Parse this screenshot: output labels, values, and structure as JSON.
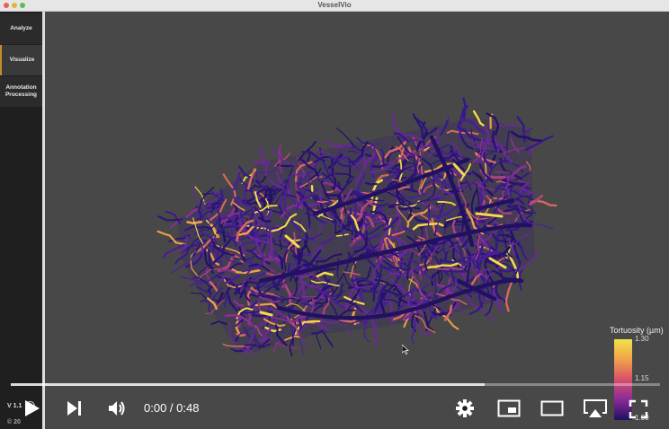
{
  "window": {
    "title": "VesselVio"
  },
  "sidebar": {
    "items": [
      {
        "label": "Analyze"
      },
      {
        "label": "Visualize",
        "active": true
      },
      {
        "label": "Annotation Processing"
      }
    ],
    "version": "V 1.1",
    "copyright": "© 20"
  },
  "viewer": {
    "colorbar": {
      "title": "Tortuosity (µm)",
      "ticks": [
        "1.30",
        "1.15",
        "1.00"
      ],
      "colors": [
        "#f2e24a",
        "#f0a24a",
        "#d8506a",
        "#8a2a9a",
        "#20105e"
      ]
    }
  },
  "player": {
    "time_current": "0:00",
    "time_total": "0:48",
    "time_display": "0:00 / 0:48",
    "progress": 0.73
  },
  "colors": {
    "accent": "#c98a2e",
    "viewport_bg": "#484848"
  }
}
